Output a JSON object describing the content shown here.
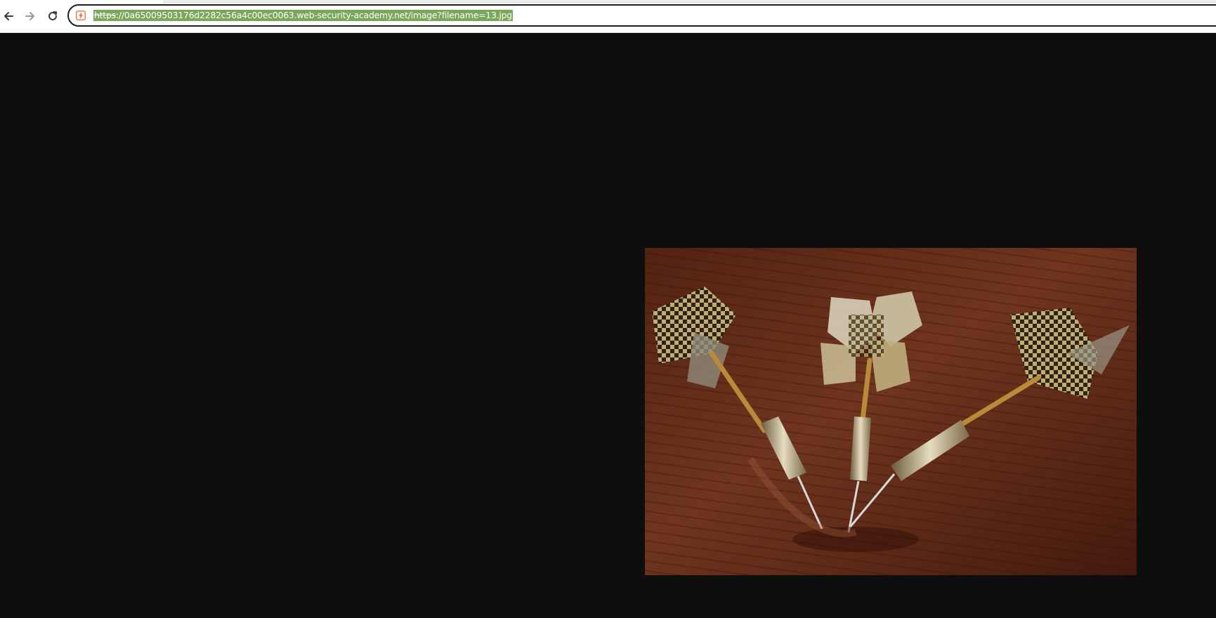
{
  "browser": {
    "nav": {
      "back_icon": "arrow-left-icon",
      "forward_icon": "arrow-right-icon",
      "reload_icon": "reload-icon"
    },
    "address_bar": {
      "site_icon": "not-secure-lock-icon",
      "scheme": "https",
      "rest": "://0a65009503176d2282c56a4c00ec0063.web-security-academy.net/image?filename=13.jpg",
      "selected": true
    }
  },
  "colors": {
    "page_background": "#0e0e0e",
    "selection": "#7aa85a",
    "site_icon_accent": "#e8743b"
  },
  "content": {
    "image": {
      "subject": "three steel darts with gold checkered flights on a wooden surface"
    }
  }
}
